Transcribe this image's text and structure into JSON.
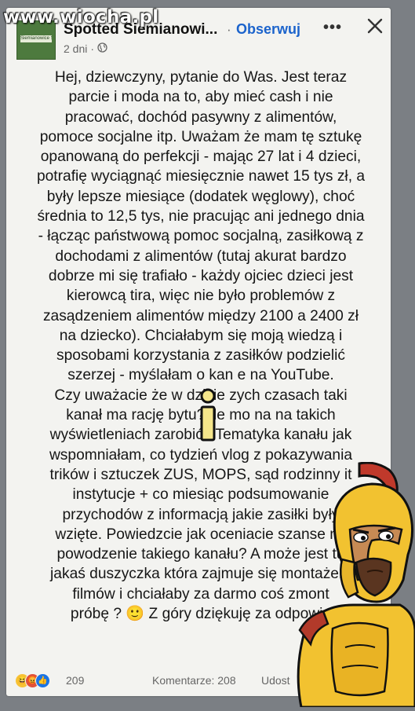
{
  "watermark": "www.wiocha.pl",
  "post": {
    "avatar_label": "Siemianowice Śl.",
    "page_name": "Spotted Siemianowi...",
    "follow_label": "Obserwuj",
    "time": "2 dni",
    "time_separator": "·",
    "body": "Hej, dziewczyny, pytanie do Was. Jest teraz\nparcie i moda na to, aby mieć cash i nie\npracować, dochód pasywny z alimentów,\npomoce socjalne itp. Uważam że mam tę sztukę\nopanowaną do perfekcji - mając 27 lat i 4 dzieci,\npotrafię wyciągnąć miesięcznie nawet 15 tys zł, a\nbyły lepsze miesiące (dodatek węglowy), choć\nśrednia to 12,5 tys, nie pracując ani jednego dnia\n- łącząc państwową pomoc socjalną, zasiłkową z\ndochodami z alimentów (tutaj akurat bardzo\ndobrze mi się trafiało - każdy ojciec dzieci jest\nkierowcą tira, więc nie było problemów z\nzasądzeniem alimentów między 2100 a 2400 zł\nna dziecko). Chciałabym się moją wiedzą i\nsposobami korzystania z zasiłków podzielić\nszerzej - myślałam o kan  e na YouTube.\nCzy uważacie że w dzisie  zych czasach taki\nkanał ma rację bytu? Ile mo  na na takich\nwyświetleniach zarobić? Tematyka kanału jak\nwspomniałam, co tydzień vlog z pokazywania\ntrików i sztuczek ZUS, MOPS, sąd rodzinny it\ninstytucje + co miesiąc podsumowanie\nprzychodów z informacją jakie zasiłki były\nwzięte. Powiedzcie jak oceniacie szanse na\npowodzenie takiego kanału? A może jest tu\njakaś duszyczka która zajmuje się montażem\nfilmów i chciałaby za darmo coś zmont\npróbę ? 🙂 Z góry dziękuję za odpowie"
  },
  "footer": {
    "reaction_count": "209",
    "comments_label": "Komentarze: 208",
    "shares_label": "Udost"
  },
  "icons": {
    "more": "more-options-icon",
    "close": "close-icon",
    "privacy": "globe-icon"
  },
  "colors": {
    "accent": "#1b63cc",
    "card_bg": "#f3f3f0",
    "page_bg": "#7b7f84"
  }
}
